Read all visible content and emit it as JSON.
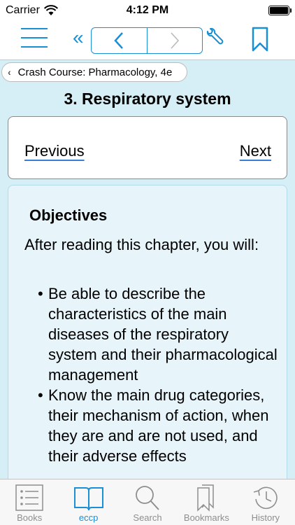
{
  "status_bar": {
    "carrier": "Carrier",
    "time": "4:12 PM"
  },
  "breadcrumb": {
    "label": "Crash Course: Pharmacology, 4e"
  },
  "chapter": {
    "title": "3. Respiratory system"
  },
  "pager": {
    "previous": "Previous",
    "next": "Next"
  },
  "content": {
    "heading": "Objectives",
    "intro": "After reading this chapter, you will:",
    "items": [
      "Be able to describe the characteristics of the main diseases of the respiratory system and their pharmacological management",
      "Know the main drug categories, their mechanism of action, when they are and are not used, and their adverse effects"
    ]
  },
  "tabs": [
    {
      "label": "Books",
      "icon": "books-icon"
    },
    {
      "label": "eccp",
      "icon": "open-book-icon"
    },
    {
      "label": "Search",
      "icon": "search-icon"
    },
    {
      "label": "Bookmarks",
      "icon": "bookmarks-icon"
    },
    {
      "label": "History",
      "icon": "history-icon"
    }
  ],
  "colors": {
    "accent": "#1a8fd6",
    "background": "#d6eef6",
    "card": "#e7f5fb",
    "inactive_tab": "#8e8e8e"
  }
}
